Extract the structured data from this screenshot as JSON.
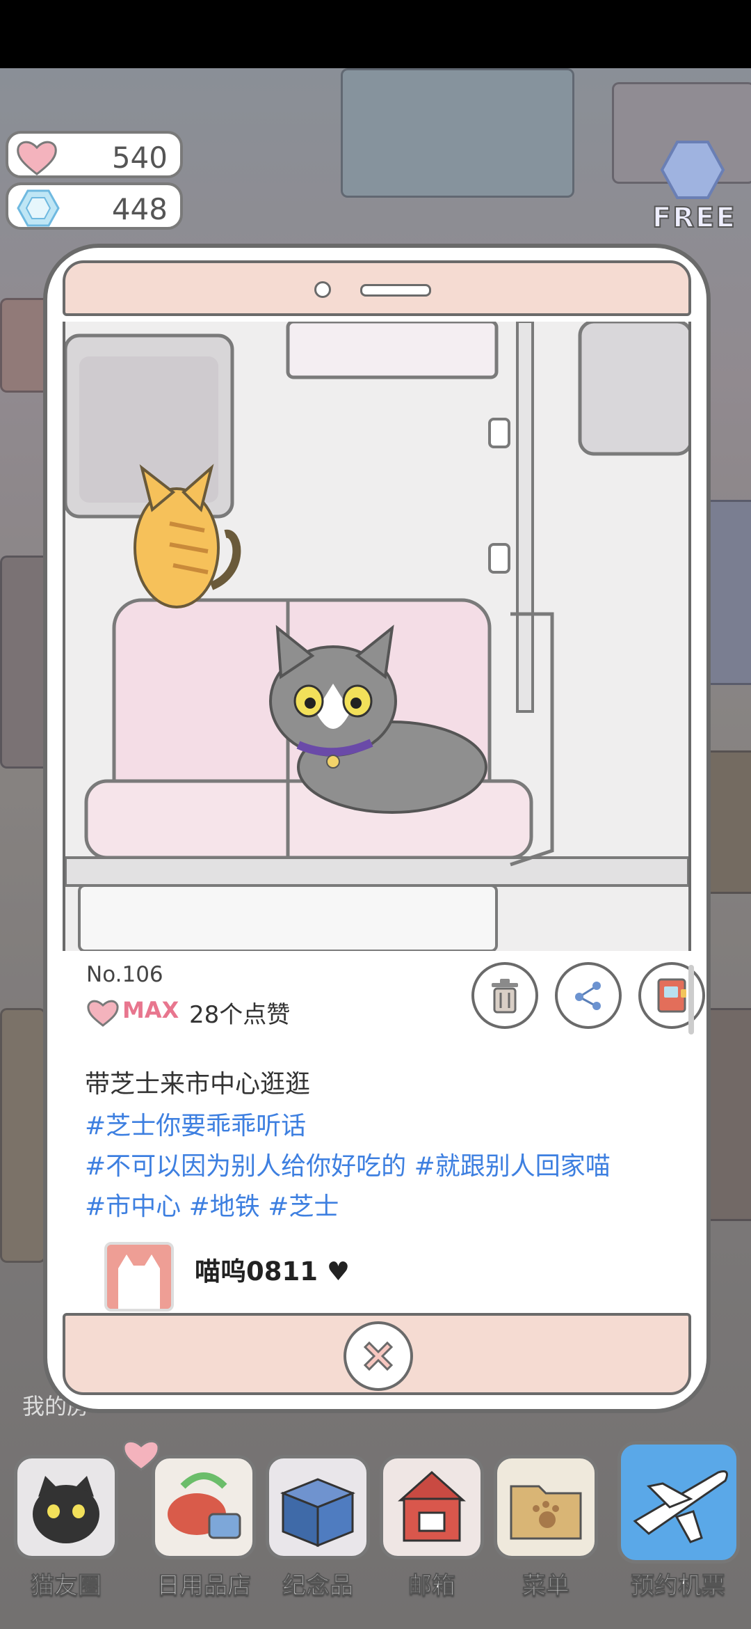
{
  "resources": {
    "hearts": "540",
    "gems": "448"
  },
  "free_label": "FREE",
  "post": {
    "number": "No.106",
    "level": "MAX",
    "likes": "28个点赞",
    "caption": "带芝士来市中心逛逛",
    "tag_lines": [
      "#芝士你要乖乖听话",
      "#不可以因为别人给你好吃的 #就跟别人回家喵",
      "#市中心 #地铁 #芝士"
    ],
    "author": "喵呜0811 ♥"
  },
  "background_label": "我的房",
  "dock": [
    {
      "label": "猫友圈",
      "icon": "cat-friends-icon",
      "color": "#3a3a3a"
    },
    {
      "label": "日用品店",
      "icon": "shop-icon",
      "color": "#d95b4a"
    },
    {
      "label": "纪念品",
      "icon": "souvenir-box-icon",
      "color": "#3f6aa8"
    },
    {
      "label": "邮箱",
      "icon": "mailbox-icon",
      "color": "#c94a42"
    },
    {
      "label": "菜单",
      "icon": "menu-folder-icon",
      "color": "#caa25e"
    },
    {
      "label": "预约机票",
      "icon": "airplane-icon",
      "color": "#3b8fd8"
    }
  ],
  "colors": {
    "accent_tag": "#3d7fe0",
    "heart_pink": "#e8768e",
    "frame_pink": "#f5dbd2"
  }
}
